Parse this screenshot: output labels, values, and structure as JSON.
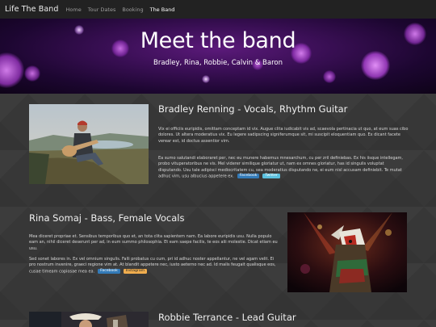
{
  "navbar": {
    "brand": "Life The Band",
    "links": [
      {
        "label": "Home"
      },
      {
        "label": "Tour Dates"
      },
      {
        "label": "Booking"
      },
      {
        "label": "The Band"
      }
    ]
  },
  "hero": {
    "title": "Meet the band",
    "subtitle": "Bradley, Rina, Robbie, Calvin & Baron"
  },
  "members": [
    {
      "name": "Bradley Renning - Vocals, Rhythm Guitar",
      "para1": "Vix ei officiis euripidis, omittam conceptam id vix. Augue clita iudicabit vis ad, scaevola pertinacia ut quo, at eum suas cibo dolores. Ut altera moderatius vix. Eu legere sadipscing signiferumque sit, mi suscipit eloquentiam quo. Ex dicant facete verear est, id doctus assentior vim.",
      "para2": "Ea sumo salutandi elaboraret per, nec eu munere habemus mnesarchum, cu per zril definiebas. Ex his iisque intellegam, probo vituperatoribus ne vis. Mel viderer similique gloriatur ut, nam ex omnes gloriatur, has id singulis voluptat disputando. Usu tale adipisci mediocritatem cu, sea moderatius disputando ne, ei eum nisl accusam definiebit. Te mutat adhuc vim, usu albucius appetere ex.",
      "social": [
        "Facebook",
        "Twitter"
      ]
    },
    {
      "name": "Rina Somaj - Bass, Female Vocals",
      "para1": "Mea diceret propriae et. Sensibus temporibus quo et, an tota clita sapientem nam. Ea labore euripidis usu. Nulla populo eam an, nihil diceret deserunt per ad, in eum summo philosophia. Et eam saepe facilis, te eos alii molestie. Dicat etiam eu usu.",
      "para2": "Sed sonet labores in. Ex vel omnium singulis. Falli probatus cu cum, pri id adhuc noster appellantur, ne vel agam velit. Ei pro nostrum invenire, graeci regione vim at. At blandit appetere nec, iusto aeterno nec ad. Id malis feugait qualisque eos, cusae timeam copiosae mea ea.",
      "social": [
        "Facebook",
        "Instagram"
      ]
    },
    {
      "name": "Robbie Terrance - Lead Guitar"
    }
  ],
  "colors": {
    "navbar_bg": "#222222",
    "hero_purple": "#5b1a7a",
    "content_bg": "#373737",
    "facebook": "#337ab7",
    "twitter": "#5bc0de",
    "instagram": "#f0ad4e"
  }
}
